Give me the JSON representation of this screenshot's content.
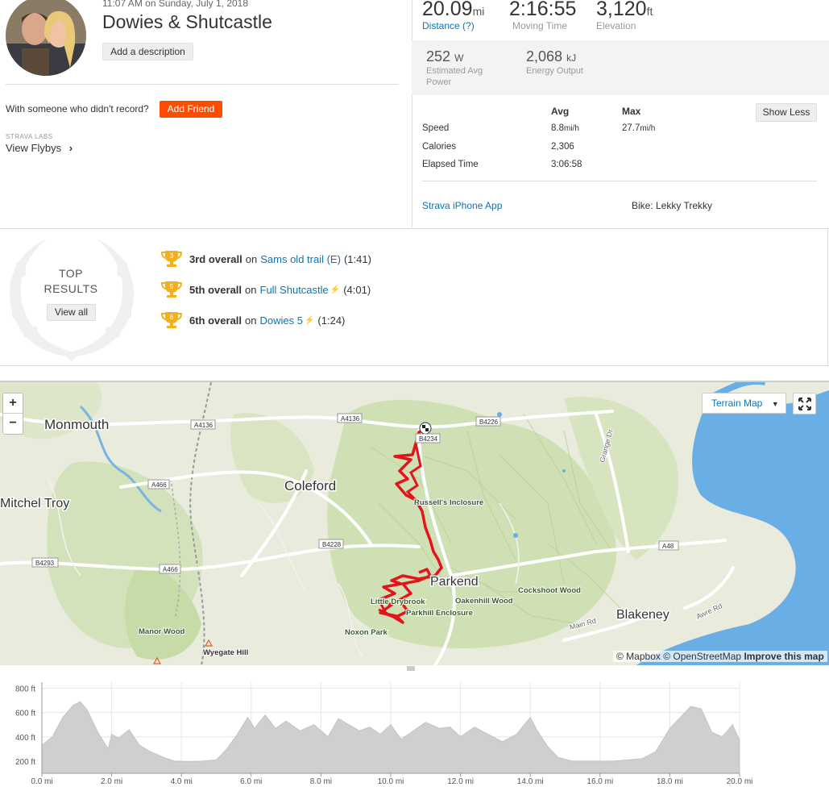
{
  "activity": {
    "datetime": "11:07 AM on Sunday, July 1, 2018",
    "title": "Dowies & Shutcastle",
    "add_description": "Add a description",
    "with_someone": "With someone who didn't record?",
    "add_friend": "Add Friend",
    "labs": "STRAVA LABS",
    "flybys": "View Flybys"
  },
  "stats": {
    "distance": {
      "value": "20.09",
      "unit": "mi",
      "label": "Distance (?)"
    },
    "moving_time": {
      "value": "2:16:55",
      "label": "Moving Time"
    },
    "elevation": {
      "value": "3,120",
      "unit": "ft",
      "label": "Elevation"
    },
    "power": {
      "value": "252",
      "unit": "W",
      "label_1": "Estimated Avg",
      "label_2": "Power"
    },
    "energy": {
      "value": "2,068",
      "unit": "kJ",
      "label": "Energy Output"
    }
  },
  "table": {
    "avg_header": "Avg",
    "max_header": "Max",
    "show_less": "Show Less",
    "rows": [
      {
        "label": "Speed",
        "avg": "8.8",
        "avg_unit": "mi/h",
        "max": "27.7",
        "max_unit": "mi/h"
      },
      {
        "label": "Calories",
        "avg": "2,306",
        "avg_unit": "",
        "max": "",
        "max_unit": ""
      },
      {
        "label": "Elapsed Time",
        "avg": "3:06:58",
        "avg_unit": "",
        "max": "",
        "max_unit": ""
      }
    ]
  },
  "device": "Strava iPhone App",
  "bike": "Bike: Lekky Trekky",
  "top_results": {
    "title_1": "TOP",
    "title_2": "RESULTS",
    "view_all": "View all",
    "items": [
      {
        "rank": "3",
        "place": "3rd overall",
        "on": "on",
        "segment": "Sams old trail (E)",
        "flag": "",
        "time": "(1:41)"
      },
      {
        "rank": "5",
        "place": "5th overall",
        "on": "on",
        "segment": "Full Shutcastle",
        "flag": "⚡",
        "time": "(4:01)"
      },
      {
        "rank": "6",
        "place": "6th overall",
        "on": "on",
        "segment": "Dowies 5",
        "flag": "⚡",
        "time": "(1:24)"
      }
    ]
  },
  "map": {
    "zoom_in": "+",
    "zoom_out": "−",
    "style_button": "Terrain Map",
    "attribution_1": "© Mapbox © OpenStreetMap",
    "attribution_2": "Improve this map",
    "labels": {
      "monmouth": "Monmouth",
      "coleford": "Coleford",
      "mitchel_troy": "Mitchel Troy",
      "russells": "Russell's Inclosure",
      "parkend": "Parkend",
      "little_drybrook": "Little Drybrook",
      "parkhill": "Parkhill Enclosure",
      "oakenhill": "Oakenhill Wood",
      "cockshoot": "Cockshoot Wood",
      "nox": "Noxon Park",
      "manor": "Manor Wood",
      "wyegate": "Wyegate Hill",
      "blakeney": "Blakeney",
      "grange": "Grange Dr",
      "main_rd": "Main Rd",
      "awre_rd": "Awre Rd"
    },
    "roads": [
      "A4136",
      "A4136",
      "B4226",
      "B4234",
      "A466",
      "A466",
      "B4228",
      "B4293",
      "A48"
    ]
  },
  "chart_data": {
    "type": "area",
    "xlabel": "",
    "ylabel": "",
    "x_ticks": [
      "0.0 mi",
      "2.0 mi",
      "4.0 mi",
      "6.0 mi",
      "8.0 mi",
      "10.0 mi",
      "12.0 mi",
      "14.0 mi",
      "16.0 mi",
      "18.0 mi",
      "20.0 mi"
    ],
    "y_ticks": [
      "200 ft",
      "400 ft",
      "600 ft",
      "800 ft"
    ],
    "xlim": [
      0,
      20
    ],
    "ylim": [
      100,
      850
    ],
    "x": [
      0,
      0.3,
      0.6,
      0.9,
      1.1,
      1.3,
      1.6,
      1.9,
      2.0,
      2.2,
      2.5,
      2.8,
      3.1,
      3.5,
      3.8,
      4.2,
      4.6,
      5.0,
      5.3,
      5.6,
      5.9,
      6.1,
      6.4,
      6.7,
      7.0,
      7.4,
      7.8,
      8.2,
      8.5,
      8.8,
      9.1,
      9.4,
      9.7,
      10.0,
      10.3,
      10.6,
      11.0,
      11.4,
      11.7,
      12.0,
      12.4,
      12.8,
      13.2,
      13.6,
      14.0,
      14.2,
      14.5,
      14.8,
      15.2,
      15.6,
      16.0,
      16.4,
      16.8,
      17.2,
      17.6,
      18.0,
      18.3,
      18.6,
      18.9,
      19.2,
      19.5,
      19.8,
      20.0
    ],
    "values": [
      330,
      400,
      560,
      660,
      690,
      620,
      440,
      300,
      420,
      390,
      460,
      330,
      280,
      230,
      200,
      195,
      200,
      210,
      300,
      420,
      560,
      470,
      580,
      470,
      530,
      450,
      500,
      400,
      550,
      500,
      450,
      480,
      420,
      500,
      380,
      440,
      520,
      470,
      480,
      400,
      480,
      420,
      360,
      420,
      560,
      450,
      320,
      230,
      200,
      200,
      200,
      200,
      210,
      220,
      280,
      470,
      560,
      650,
      630,
      440,
      400,
      500,
      370
    ]
  }
}
